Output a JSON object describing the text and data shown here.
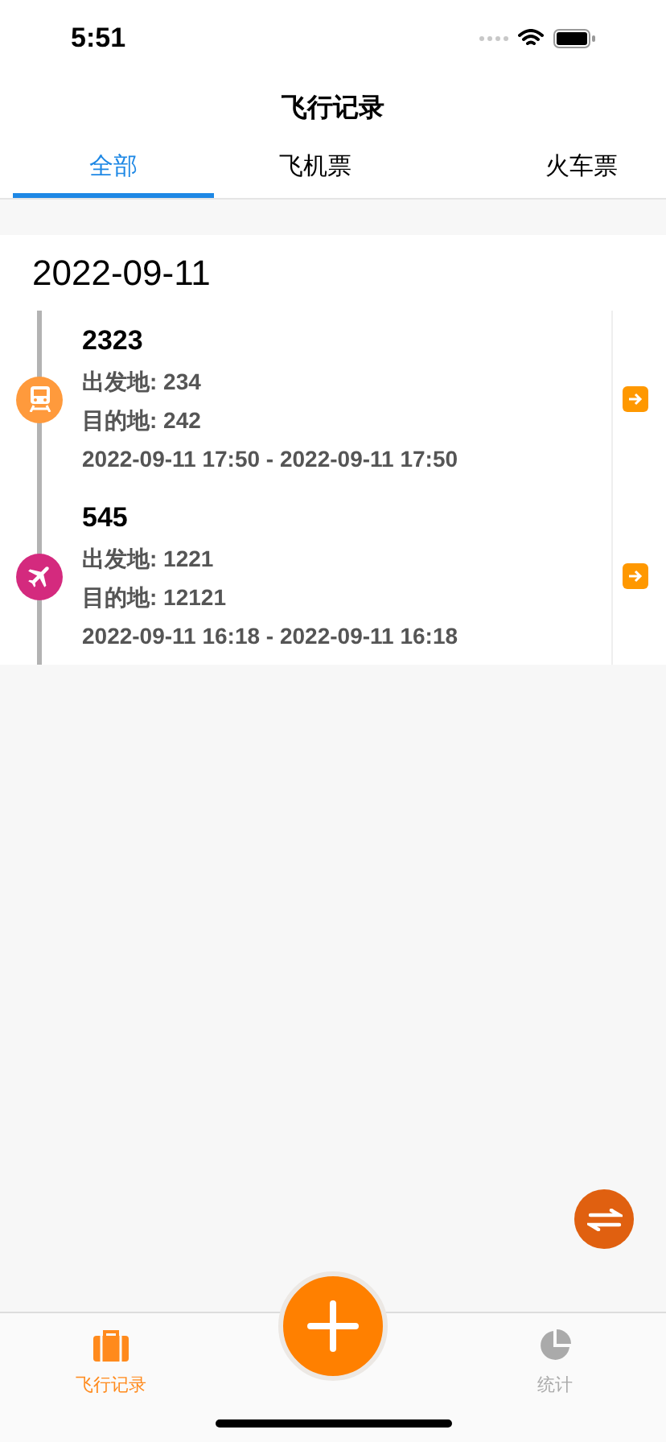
{
  "status_bar": {
    "time": "5:51"
  },
  "header": {
    "title": "飞行记录"
  },
  "tabs": [
    {
      "label": "全部",
      "selected": true
    },
    {
      "label": "飞机票",
      "selected": false
    },
    {
      "label": "火车票",
      "selected": false
    }
  ],
  "groups": [
    {
      "date": "2022-09-11",
      "records": [
        {
          "kind": "train",
          "color": "#ff9a3c",
          "number": "2323",
          "from": "出发地: 234",
          "to": "目的地: 242",
          "time": "2022-09-11 17:50 - 2022-09-11 17:50"
        },
        {
          "kind": "plane",
          "color": "#d42a7e",
          "number": "545",
          "from": "出发地: 1221",
          "to": "目的地: 12121",
          "time": "2022-09-11 16:18 - 2022-09-11 16:18"
        }
      ]
    }
  ],
  "bottom_tabs": [
    {
      "kind": "records",
      "label": "飞行记录",
      "selected": true
    },
    {
      "kind": "stats",
      "label": "统计",
      "selected": false
    }
  ]
}
